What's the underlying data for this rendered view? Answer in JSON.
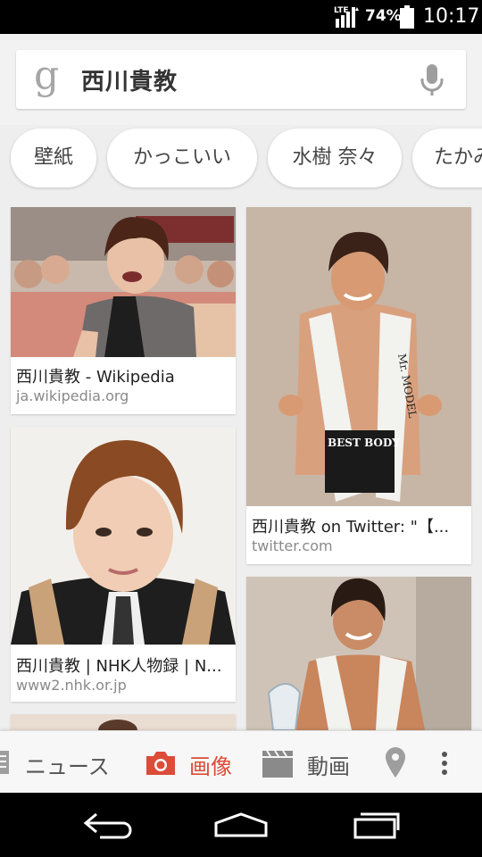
{
  "status": {
    "network": "LTE",
    "battery": "74%",
    "time": "10:17"
  },
  "search": {
    "logo": "g",
    "query": "西川貴教",
    "mic_icon": "microphone-icon"
  },
  "chips": [
    "壁紙",
    "かっこいい",
    "水樹 奈々",
    "たかみ"
  ],
  "results": [
    {
      "title": "西川貴教 - Wikipedia",
      "domain": "ja.wikipedia.org"
    },
    {
      "title": "西川貴教 on Twitter: \"【...",
      "domain": "twitter.com"
    },
    {
      "title": "西川貴教 | NHK人物録 | N...",
      "domain": "www2.nhk.or.jp"
    },
    {
      "title": "",
      "domain": ""
    }
  ],
  "image_text": {
    "sash": "Mr. MODEL",
    "shorts": "BEST BODY"
  },
  "tabs": {
    "news": "ニュース",
    "images": "画像",
    "videos": "動画"
  },
  "colors": {
    "accent": "#dd4b39",
    "status_bar": "#000000"
  }
}
